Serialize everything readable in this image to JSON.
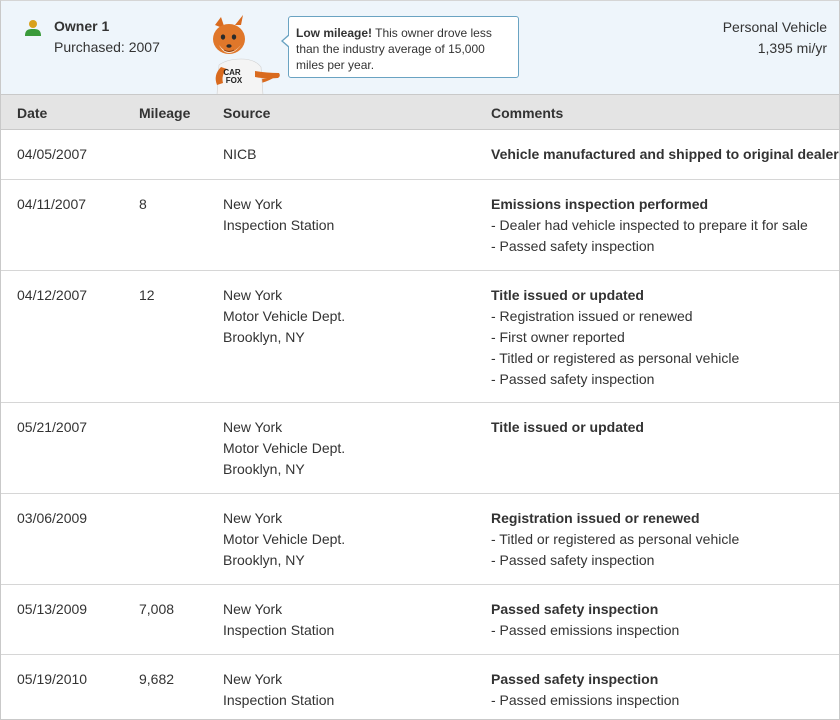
{
  "owner": {
    "title": "Owner 1",
    "purchased": "Purchased: 2007",
    "vehicle_type": "Personal Vehicle",
    "mileage_per_year": "1,395 mi/yr",
    "icon": "person-icon",
    "mascot": "carfox-mascot",
    "mascot_sign": [
      "CAR",
      "FOX"
    ]
  },
  "callout": {
    "highlight": "Low mileage!",
    "text": " This owner drove less than the industry average of 15,000 miles per year."
  },
  "table": {
    "headers": {
      "date": "Date",
      "mileage": "Mileage",
      "source": "Source",
      "comments": "Comments"
    },
    "rows": [
      {
        "date": "04/05/2007",
        "mileage": "",
        "source": [
          "NICB"
        ],
        "title": "Vehicle manufactured and shipped to original dealer",
        "details": []
      },
      {
        "date": "04/11/2007",
        "mileage": "8",
        "source": [
          "New York",
          "Inspection Station"
        ],
        "title": "Emissions inspection performed",
        "details": [
          "- Dealer had vehicle inspected to prepare it for sale",
          "- Passed safety inspection"
        ]
      },
      {
        "date": "04/12/2007",
        "mileage": "12",
        "source": [
          "New York",
          "Motor Vehicle Dept.",
          "Brooklyn, NY"
        ],
        "title": "Title issued or updated",
        "details": [
          "- Registration issued or renewed",
          "- First owner reported",
          "- Titled or registered as personal vehicle",
          "- Passed safety inspection"
        ]
      },
      {
        "date": "05/21/2007",
        "mileage": "",
        "source": [
          "New York",
          "Motor Vehicle Dept.",
          "Brooklyn, NY"
        ],
        "title": "Title issued or updated",
        "details": []
      },
      {
        "date": "03/06/2009",
        "mileage": "",
        "source": [
          "New York",
          "Motor Vehicle Dept.",
          "Brooklyn, NY"
        ],
        "title": "Registration issued or renewed",
        "details": [
          "- Titled or registered as personal vehicle",
          "- Passed safety inspection"
        ]
      },
      {
        "date": "05/13/2009",
        "mileage": "7,008",
        "source": [
          "New York",
          "Inspection Station"
        ],
        "title": "Passed safety inspection",
        "details": [
          "- Passed emissions inspection"
        ]
      },
      {
        "date": "05/19/2010",
        "mileage": "9,682",
        "source": [
          "New York",
          "Inspection Station"
        ],
        "title": "Passed safety inspection",
        "details": [
          "- Passed emissions inspection"
        ]
      }
    ]
  }
}
